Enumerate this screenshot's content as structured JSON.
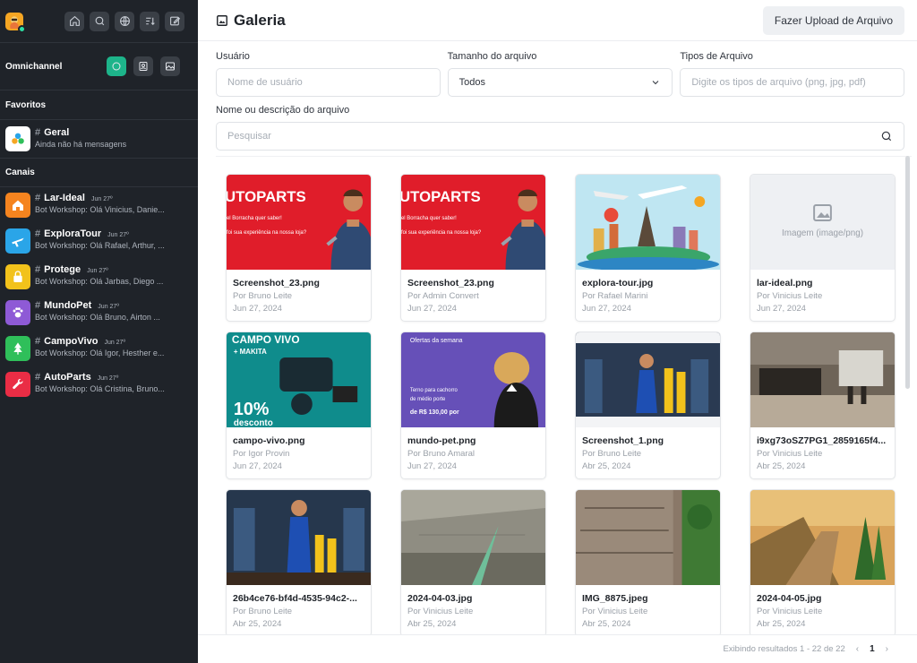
{
  "sidebar": {
    "omnichannel_label": "Omnichannel",
    "favorites_title": "Favoritos",
    "channels_title": "Canais",
    "favorites": [
      {
        "name": "Geral",
        "msg": "Ainda não há mensagens",
        "date": ""
      }
    ],
    "channels": [
      {
        "name": "Lar-Ideal",
        "date": "Jun 27º",
        "msg": "Bot Workshop: Olá Vinicius, Danie...",
        "color": "#f5841f"
      },
      {
        "name": "ExploraTour",
        "date": "Jun 27º",
        "msg": "Bot Workshop: Olá Rafael, Arthur, ...",
        "color": "#2aa5e8"
      },
      {
        "name": "Protege",
        "date": "Jun 27º",
        "msg": "Bot Workshop: Olá Jarbas, Diego ...",
        "color": "#f2c21b"
      },
      {
        "name": "MundoPet",
        "date": "Jun 27º",
        "msg": "Bot Workshop: Olá Bruno, Airton ...",
        "color": "#8e5ad6"
      },
      {
        "name": "CampoVivo",
        "date": "Jun 27º",
        "msg": "Bot Workshop: Olá Igor, Hesther e...",
        "color": "#2fbf5a"
      },
      {
        "name": "AutoParts",
        "date": "Jun 27º",
        "msg": "Bot Workshop: Olá Cristina, Bruno...",
        "color": "#ea2d45"
      }
    ]
  },
  "header": {
    "title": "Galeria",
    "upload_label": "Fazer Upload de Arquivo"
  },
  "filters": {
    "user_label": "Usuário",
    "user_placeholder": "Nome de usuário",
    "size_label": "Tamanho do arquivo",
    "size_value": "Todos",
    "types_label": "Tipos de Arquivo",
    "types_placeholder": "Digite os tipos de arquivo (png, jpg, pdf)",
    "name_label": "Nome ou descrição do arquivo",
    "search_placeholder": "Pesquisar"
  },
  "cards": [
    {
      "name": "Screenshot_23.png",
      "by": "Por Bruno Leite",
      "date": "Jun 27, 2024",
      "thumb": "autoparts",
      "thumb_text": "UTOPARTS",
      "thumb_line1": "el Borracha quer saber!",
      "thumb_line2": "foi sua experiência na nossa loja?"
    },
    {
      "name": "Screenshot_23.png",
      "by": "Por Admin Convert",
      "date": "Jun 27, 2024",
      "thumb": "autoparts",
      "thumb_text": "UTOPARTS",
      "thumb_line1": "el Borracha quer saber!",
      "thumb_line2": "foi sua experiência na nossa loja?"
    },
    {
      "name": "explora-tour.jpg",
      "by": "Por Rafael Marini",
      "date": "Jun 27, 2024",
      "thumb": "tour"
    },
    {
      "name": "lar-ideal.png",
      "by": "Por Vinicius Leite",
      "date": "Jun 27, 2024",
      "thumb": "placeholder",
      "thumb_text": "Imagem (image/png)"
    },
    {
      "name": "campo-vivo.png",
      "by": "Por Igor Provin",
      "date": "Jun 27, 2024",
      "thumb": "campo",
      "thumb_text": "CAMPO VIVO",
      "thumb_line1": "+ MAKITA",
      "thumb_line2": "10%",
      "thumb_line3": "desconto"
    },
    {
      "name": "mundo-pet.png",
      "by": "Por Bruno Amaral",
      "date": "Jun 27, 2024",
      "thumb": "pet",
      "thumb_text": "Ofertas da semana",
      "thumb_line1": "Terno para cachorro",
      "thumb_line2": "de médio porte",
      "thumb_line3": "de R$ 130,00 por"
    },
    {
      "name": "Screenshot_1.png",
      "by": "Por Bruno Leite",
      "date": "Abr 25, 2024",
      "thumb": "garage"
    },
    {
      "name": "i9xg73oSZ7PG1_2859165f4...",
      "by": "Por Vinicius Leite",
      "date": "Abr 25, 2024",
      "thumb": "interior"
    },
    {
      "name": "26b4ce76-bf4d-4535-94c2-...",
      "by": "Por Bruno Leite",
      "date": "Abr 25, 2024",
      "thumb": "garage2"
    },
    {
      "name": "2024-04-03.jpg",
      "by": "Por Vinicius Leite",
      "date": "Abr 25, 2024",
      "thumb": "wall"
    },
    {
      "name": "IMG_8875.jpeg",
      "by": "Por Vinicius Leite",
      "date": "Abr 25, 2024",
      "thumb": "stairs"
    },
    {
      "name": "2024-04-05.jpg",
      "by": "Por Vinicius Leite",
      "date": "Abr 25, 2024",
      "thumb": "sunset"
    }
  ],
  "footer": {
    "results": "Exibindo resultados 1 - 22 de 22",
    "prev": "‹",
    "page": "1",
    "next": "›"
  },
  "icons": {
    "home": "home-icon",
    "search": "search-icon",
    "directory": "globe-icon",
    "sort": "sort-icon",
    "create": "pencil-square-icon"
  }
}
